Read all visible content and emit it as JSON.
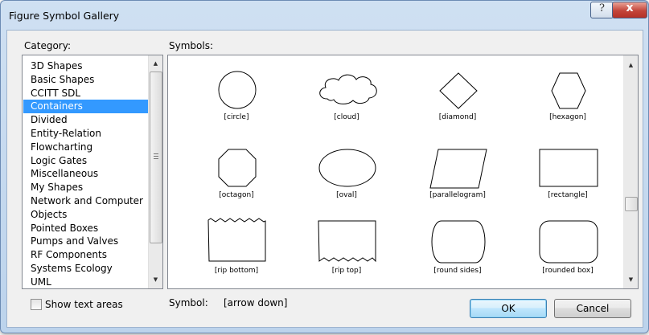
{
  "window": {
    "title": "Figure Symbol Gallery",
    "help_glyph": "?",
    "close_glyph": "x"
  },
  "category": {
    "label": "Category:",
    "items": [
      "3D Shapes",
      "Basic Shapes",
      "CCITT SDL",
      "Containers",
      "Divided",
      "Entity-Relation",
      "Flowcharting",
      "Logic Gates",
      "Miscellaneous",
      "My Shapes",
      "Network and Computer",
      "Objects",
      "Pointed Boxes",
      "Pumps and Valves",
      "RF Components",
      "Systems Ecology",
      "UML"
    ],
    "selected_index": 3
  },
  "symbols": {
    "label": "Symbols:",
    "items": [
      {
        "name": "[circle]",
        "shape": "circle"
      },
      {
        "name": "[cloud]",
        "shape": "cloud"
      },
      {
        "name": "[diamond]",
        "shape": "diamond"
      },
      {
        "name": "[hexagon]",
        "shape": "hexagon"
      },
      {
        "name": "[octagon]",
        "shape": "octagon"
      },
      {
        "name": "[oval]",
        "shape": "oval"
      },
      {
        "name": "[parallelogram]",
        "shape": "parallelogram"
      },
      {
        "name": "[rectangle]",
        "shape": "rectangle"
      },
      {
        "name": "[rip bottom]",
        "shape": "rip-bottom"
      },
      {
        "name": "[rip top]",
        "shape": "rip-top"
      },
      {
        "name": "[round sides]",
        "shape": "round-sides"
      },
      {
        "name": "[rounded box]",
        "shape": "rounded-box"
      }
    ]
  },
  "show_text_areas": {
    "label": "Show text areas",
    "checked": false
  },
  "current_symbol": {
    "label": "Symbol:",
    "value": "[arrow down]"
  },
  "buttons": {
    "ok": "OK",
    "cancel": "Cancel"
  },
  "colors": {
    "selection": "#3399ff",
    "title_bar": "#c6dbf0",
    "close_button": "#c3453a"
  }
}
